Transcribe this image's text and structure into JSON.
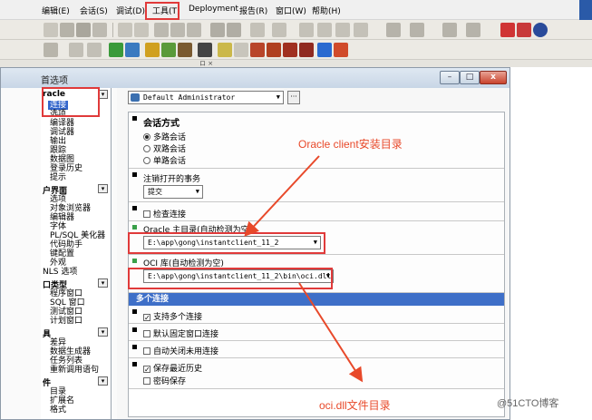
{
  "menu": {
    "items": [
      "编辑(E)",
      "会话(S)",
      "调试(D)",
      "工具(T)",
      "Deployment",
      "报告(R)",
      "窗口(W)",
      "帮助(H)"
    ]
  },
  "dialog": {
    "title": "首选项",
    "min_glyph": "–",
    "max_glyph": "□",
    "close_glyph": "x"
  },
  "tree": {
    "groups": [
      {
        "label": "racle",
        "items": [
          "连接",
          "选项",
          "编译器",
          "调试器",
          "输出",
          "跟踪",
          "数据图",
          "登录历史",
          "提示"
        ]
      },
      {
        "label": "户界面",
        "items": [
          "选项",
          "对象浏览器",
          "编辑器",
          "字体",
          "PL/SQL 美化器",
          "代码助手",
          "键配置",
          "外观",
          "NLS 选项"
        ]
      },
      {
        "label": "口类型",
        "items": [
          "程序窗口",
          "SQL 窗口",
          "测试窗口",
          "计划窗口"
        ]
      },
      {
        "label": "具",
        "items": [
          "差异",
          "数据生成器",
          "任务列表",
          "重新调用语句"
        ]
      },
      {
        "label": "件",
        "items": [
          "目录",
          "扩展名",
          "格式"
        ]
      }
    ]
  },
  "profile": {
    "value": "Default Administrator",
    "more_label": "···"
  },
  "sections": {
    "session_mode": {
      "title": "会话方式",
      "options": [
        "多路会话",
        "双路会话",
        "单路会话"
      ],
      "selected_index": 0
    },
    "pending_txn": {
      "title": "注销打开的事务",
      "value": "提交"
    },
    "check_connection": {
      "label": "检查连接",
      "checked": false
    },
    "oracle_home": {
      "title": "Oracle 主目录(自动检测为空)",
      "value": "E:\\app\\gong\\instantclient_11_2"
    },
    "oci_library": {
      "title": "OCI 库(自动检测为空)",
      "value": "E:\\app\\gong\\instantclient_11_2\\bin\\oci.dll"
    },
    "multi_connection": {
      "header": "多个连接",
      "support_multi": {
        "label": "支持多个连接",
        "checked": true
      },
      "default_fixed": {
        "label": "默认固定窗口连接",
        "checked": false
      },
      "auto_close": {
        "label": "自动关闭未用连接",
        "checked": false
      },
      "save_history": {
        "label": "保存最近历史",
        "checked": true
      },
      "save_password": {
        "label": "密码保存",
        "checked": false
      }
    }
  },
  "annotations": {
    "oracle_client_dir": "Oracle client安装目录",
    "oci_dll_dir": "oci.dll文件目录"
  },
  "watermark": "@51CTO博客",
  "colors": {
    "annotation": "#e8492a",
    "selection": "#3366cc",
    "section_header": "#3e6fc8"
  },
  "icons": [
    "save-icon",
    "print-icon",
    "search-icon",
    "run-icon",
    "stop-icon",
    "help-icon",
    "arrow-left-icon",
    "arrow-right-icon"
  ]
}
